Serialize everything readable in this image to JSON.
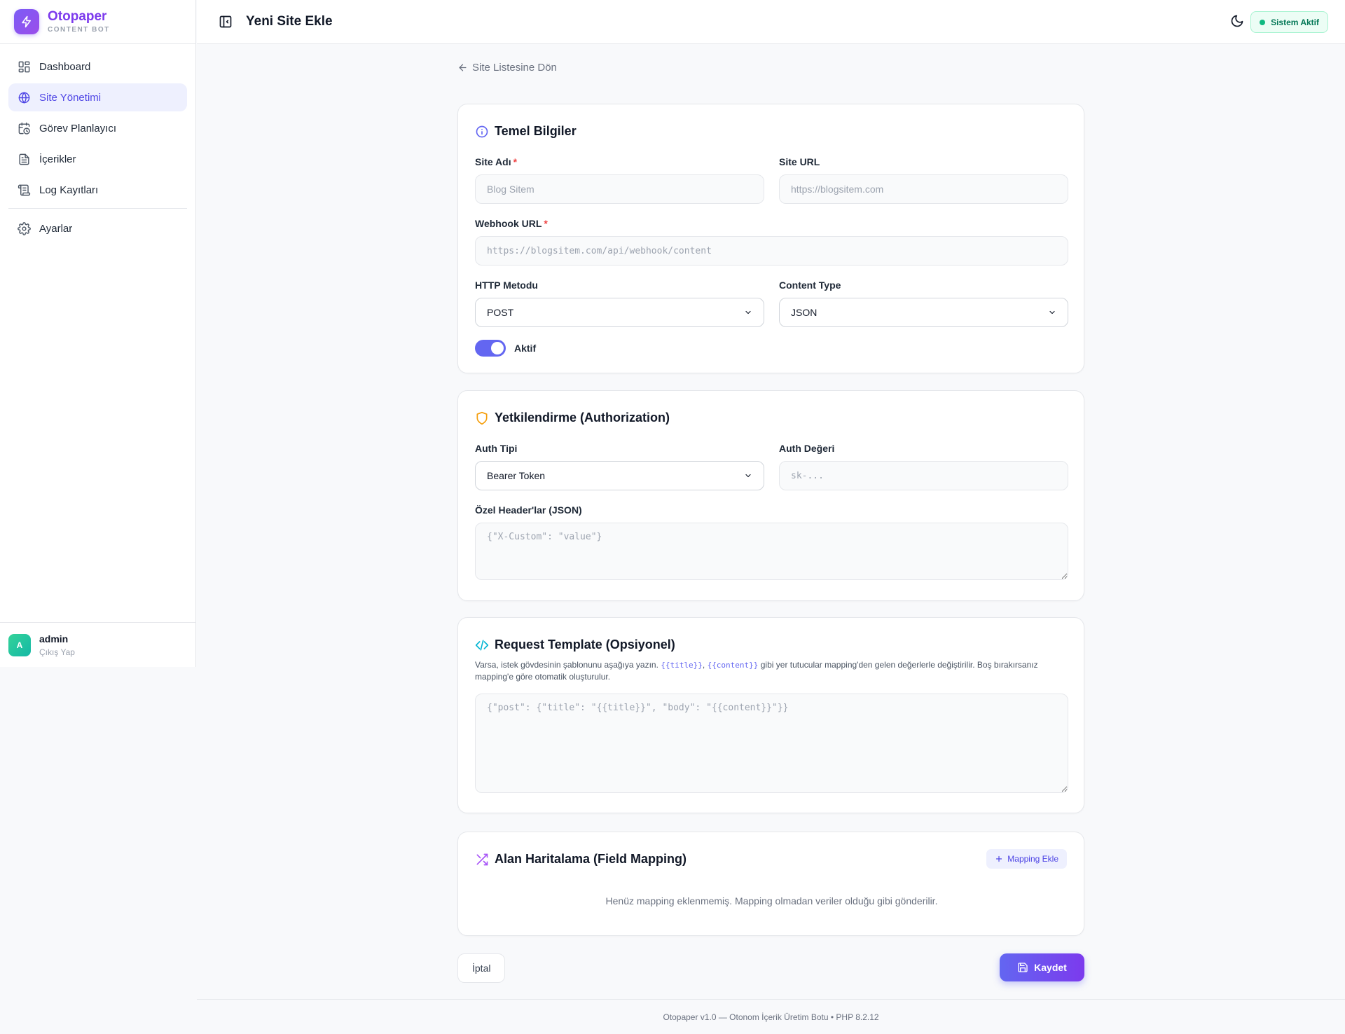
{
  "brand": {
    "name": "Otopaper",
    "subtitle": "CONTENT BOT"
  },
  "sidebar": {
    "items": [
      {
        "label": "Dashboard",
        "icon": "dashboard-icon"
      },
      {
        "label": "Site Yönetimi",
        "icon": "globe-icon",
        "active": true
      },
      {
        "label": "Görev Planlayıcı",
        "icon": "calendar-clock-icon"
      },
      {
        "label": "İçerikler",
        "icon": "document-icon"
      },
      {
        "label": "Log Kayıtları",
        "icon": "scroll-icon"
      },
      {
        "label": "Ayarlar",
        "icon": "gear-icon"
      }
    ]
  },
  "user": {
    "initial": "A",
    "name": "admin",
    "logout": "Çıkış Yap"
  },
  "header": {
    "title": "Yeni Site Ekle",
    "status": "Sistem Aktif"
  },
  "back_link": "Site Listesine Dön",
  "basic": {
    "title": "Temel Bilgiler",
    "site_name": {
      "label": "Site Adı",
      "placeholder": "Blog Sitem"
    },
    "site_url": {
      "label": "Site URL",
      "placeholder": "https://blogsitem.com"
    },
    "webhook": {
      "label": "Webhook URL",
      "placeholder": "https://blogsitem.com/api/webhook/content"
    },
    "method": {
      "label": "HTTP Metodu",
      "value": "POST"
    },
    "content_type": {
      "label": "Content Type",
      "value": "JSON"
    },
    "active_label": "Aktif"
  },
  "auth": {
    "title": "Yetkilendirme (Authorization)",
    "type": {
      "label": "Auth Tipi",
      "value": "Bearer Token"
    },
    "value": {
      "label": "Auth Değeri",
      "placeholder": "sk-..."
    },
    "headers": {
      "label": "Özel Header'lar (JSON)",
      "placeholder": "{\"X-Custom\": \"value\"}"
    }
  },
  "template": {
    "title": "Request Template (Opsiyonel)",
    "desc_before": "Varsa, istek gövdesinin şablonunu aşağıya yazın. ",
    "tag_title": "{{title}}",
    "sep": ", ",
    "tag_content": "{{content}}",
    "desc_after": " gibi yer tutucular mapping'den gelen değerlerle değiştirilir. Boş bırakırsanız mapping'e göre otomatik oluşturulur.",
    "placeholder": "{\"post\": {\"title\": \"{{title}}\", \"body\": \"{{content}}\"}}"
  },
  "mapping": {
    "title": "Alan Haritalama (Field Mapping)",
    "add_label": "Mapping Ekle",
    "empty": "Henüz mapping eklenmemiş. Mapping olmadan veriler olduğu gibi gönderilir."
  },
  "actions": {
    "cancel": "İptal",
    "save": "Kaydet"
  },
  "footer": "Otopaper v1.0 — Otonom İçerik Üretim Botu • PHP 8.2.12"
}
